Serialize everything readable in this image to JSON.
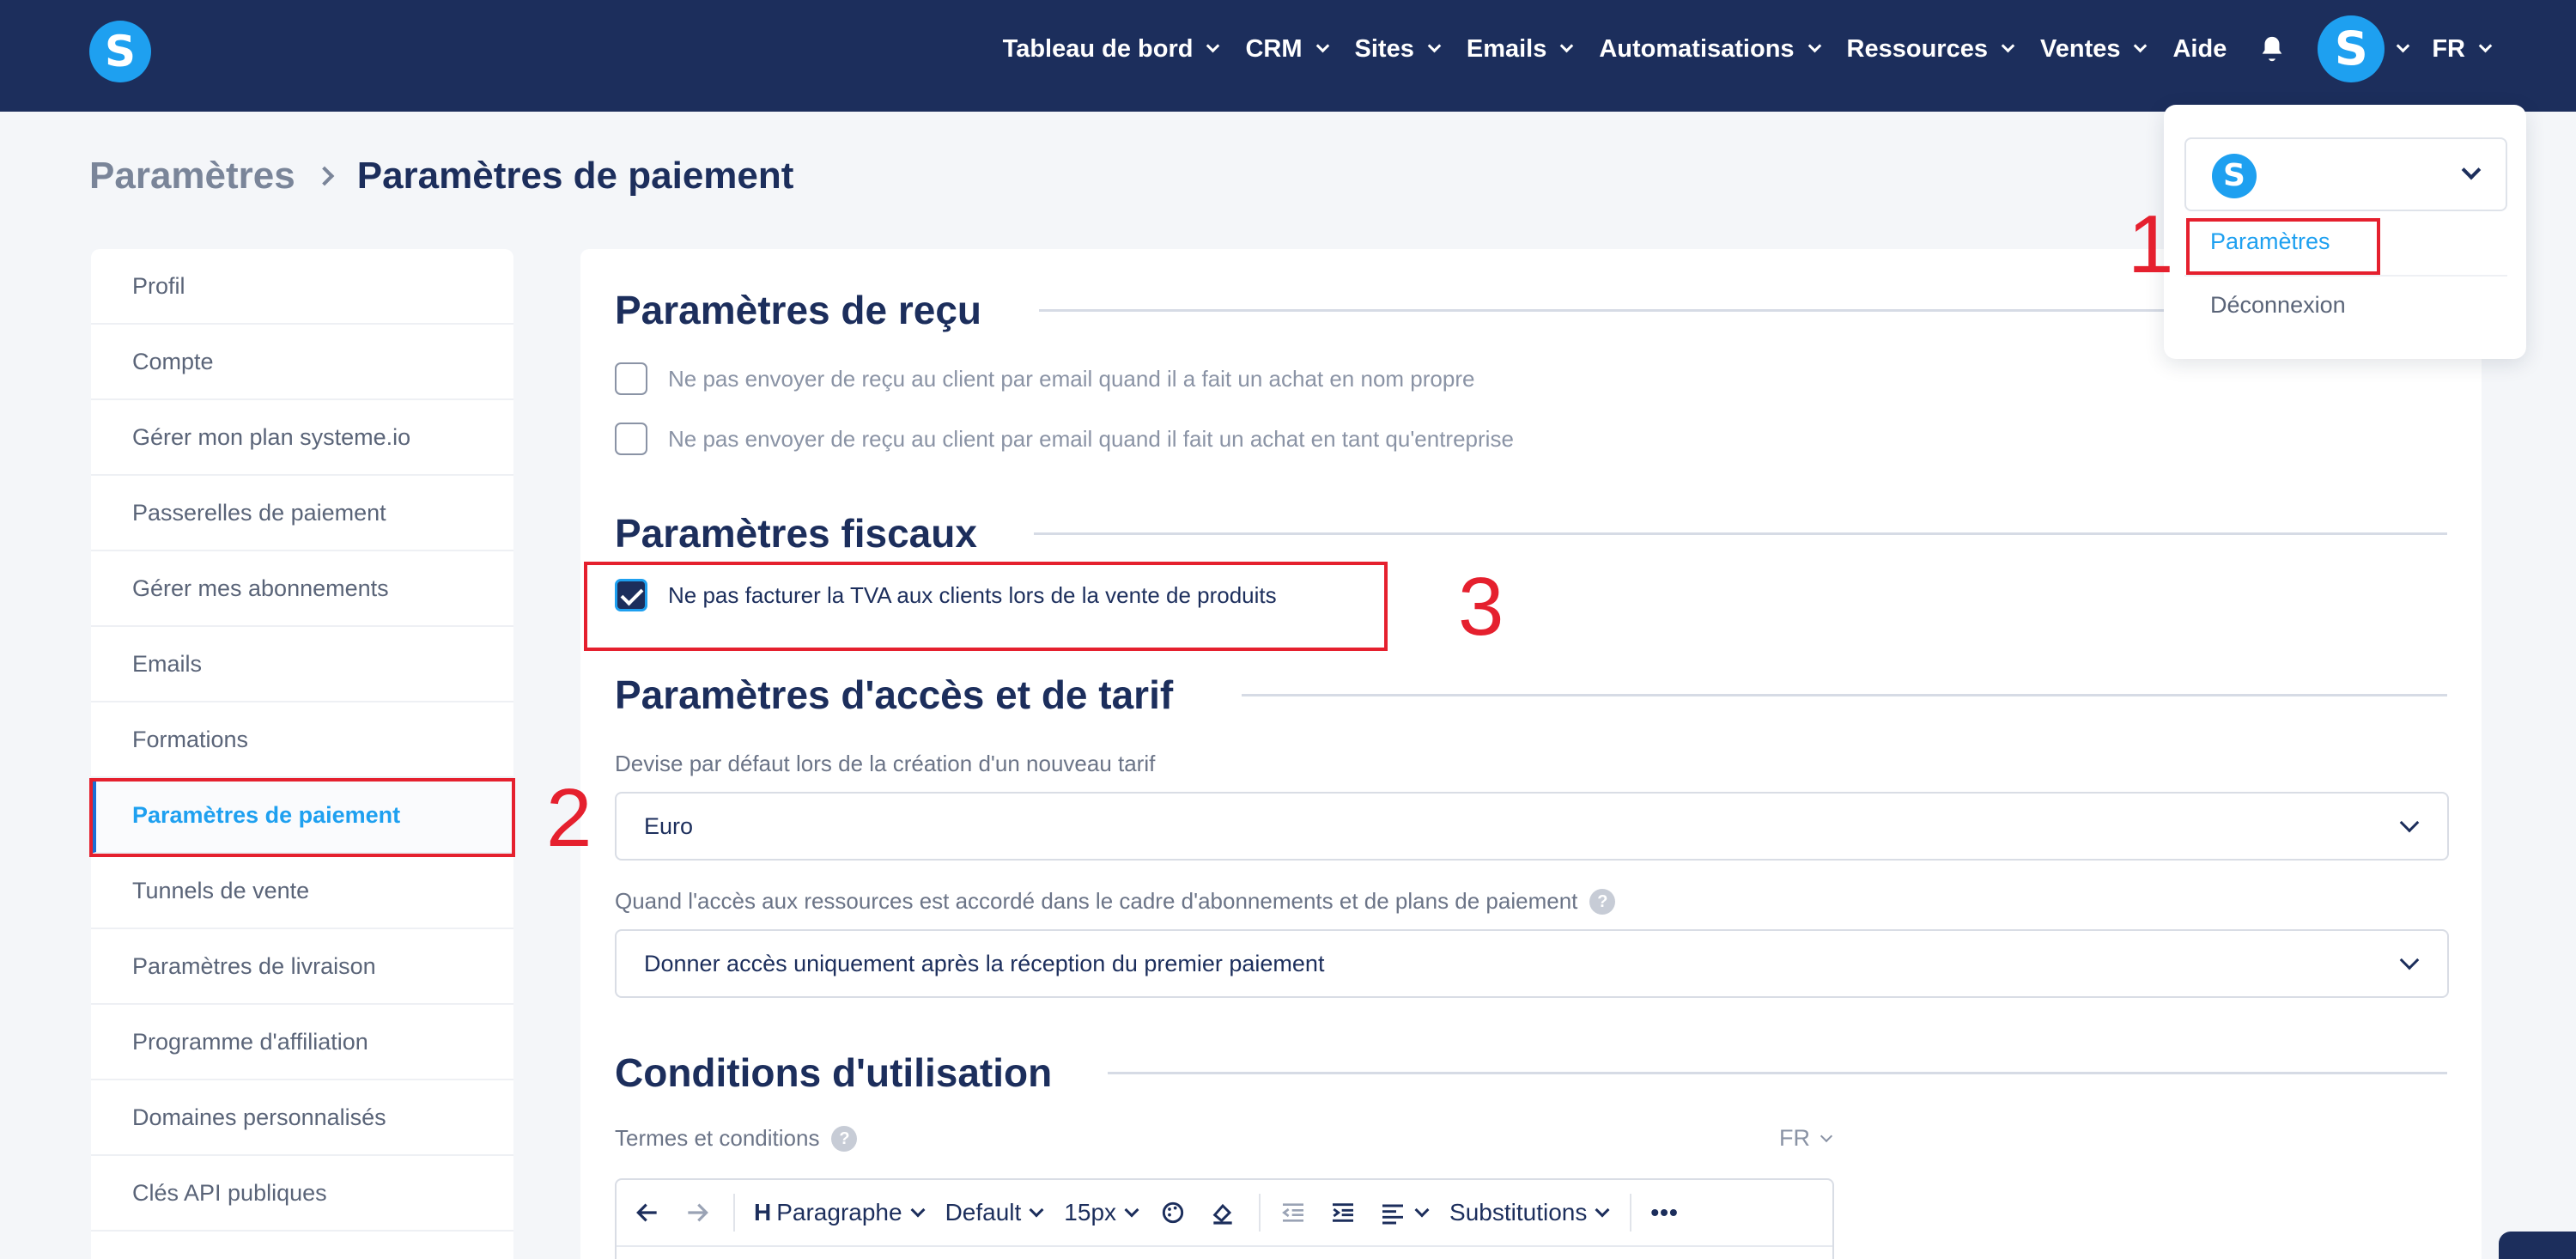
{
  "nav": {
    "logo_letter": "S",
    "items": [
      "Tableau de bord",
      "CRM",
      "Sites",
      "Emails",
      "Automatisations",
      "Ressources",
      "Ventes"
    ],
    "help": "Aide",
    "avatar_letter": "S",
    "language": "FR"
  },
  "breadcrumb": {
    "parent": "Paramètres",
    "current": "Paramètres de paiement"
  },
  "sidebar": {
    "items": [
      "Profil",
      "Compte",
      "Gérer mon plan systeme.io",
      "Passerelles de paiement",
      "Gérer mes abonnements",
      "Emails",
      "Formations",
      "Paramètres de paiement",
      "Tunnels de vente",
      "Paramètres de livraison",
      "Programme d'affiliation",
      "Domaines personnalisés",
      "Clés API publiques"
    ],
    "active_index": 7
  },
  "receipt": {
    "title": "Paramètres de reçu",
    "options": [
      "Ne pas envoyer de reçu au client par email quand il a fait un achat en nom propre",
      "Ne pas envoyer de reçu au client par email quand il fait un achat en tant qu'entreprise"
    ]
  },
  "tax": {
    "title": "Paramètres fiscaux",
    "option": "Ne pas facturer la TVA aux clients lors de la vente de produits",
    "checked": true
  },
  "access": {
    "title": "Paramètres d'accès et de tarif",
    "currency_label": "Devise par défaut lors de la création d'un nouveau tarif",
    "currency_value": "Euro",
    "access_label": "Quand l'accès aux ressources est accordé dans le cadre d'abonnements et de plans de paiement",
    "access_value": "Donner accès uniquement après la réception du premier paiement",
    "help_glyph": "?"
  },
  "terms": {
    "title": "Conditions d'utilisation",
    "label": "Termes et conditions",
    "language": "FR",
    "toolbar": {
      "paragraph": "Paragraphe",
      "font": "Default",
      "size": "15px",
      "substitutions": "Substitutions",
      "more": "•••"
    }
  },
  "dropdown": {
    "settings": "Paramètres",
    "logout": "Déconnexion"
  },
  "annotations": [
    "1",
    "2",
    "3"
  ],
  "colors": {
    "nav_bg": "#1c2e5c",
    "brand_blue": "#1ea0f0",
    "highlight_red": "#e5202e"
  }
}
